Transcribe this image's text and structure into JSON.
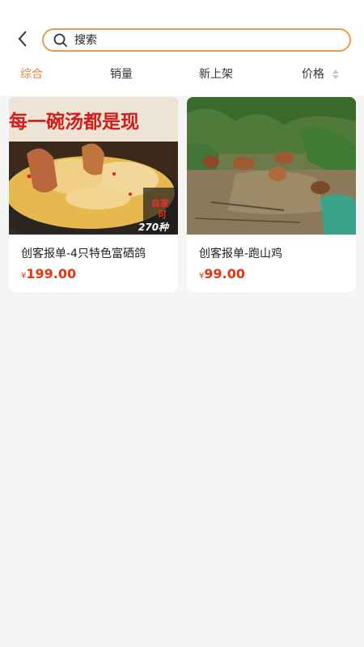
{
  "search": {
    "placeholder": "搜索"
  },
  "sort_tabs": [
    {
      "label": "综合",
      "active": true
    },
    {
      "label": "销量",
      "active": false
    },
    {
      "label": "新上架",
      "active": false
    },
    {
      "label": "价格",
      "active": false
    }
  ],
  "products": [
    {
      "title": "创客报单-4只特色富硒鸽",
      "currency": "¥",
      "price": "199.00",
      "image_text": [
        "每一碗汤都是现",
        "自家",
        "可",
        "270种"
      ]
    },
    {
      "title": "创客报单-跑山鸡",
      "currency": "¥",
      "price": "99.00"
    }
  ],
  "colors": {
    "accent": "#e8823a",
    "price": "#e8330f",
    "search_border": "#e89a4e"
  }
}
